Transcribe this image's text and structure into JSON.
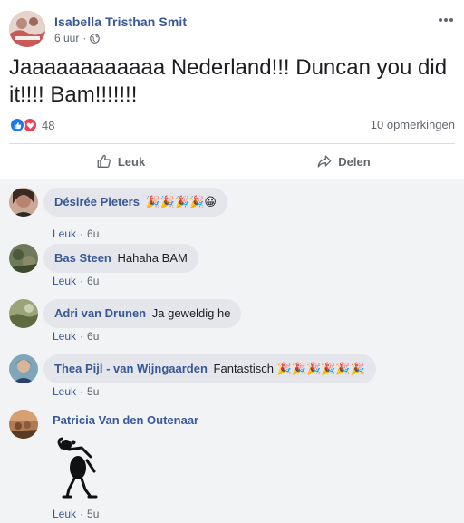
{
  "post": {
    "author": "Isabella Tristhan Smit",
    "time": "6 uur",
    "meta_separator": "·",
    "text": "Jaaaaaaaaaaaa Nederland!!! Duncan you did it!!!! Bam!!!!!!!",
    "reaction_count": "48",
    "comments_count": "10 opmerkingen",
    "reaction_types": [
      "like",
      "love"
    ]
  },
  "actions": {
    "like_label": "Leuk",
    "share_label": "Delen"
  },
  "colors": {
    "link": "#385898",
    "bubble": "#e4e6eb",
    "comments_bg": "#f2f3f5",
    "like_blue": "#1877f2",
    "love_red": "#f33e58"
  },
  "comments": [
    {
      "name": "Désirée Pieters",
      "text": "🎉🎉🎉🎉😀",
      "like_label": "Leuk",
      "sep": "·",
      "time": "6u"
    },
    {
      "name": "Bas Steen",
      "text": "Hahaha BAM",
      "like_label": "Leuk",
      "sep": "·",
      "time": "6u"
    },
    {
      "name": "Adri van Drunen",
      "text": "Ja geweldig he",
      "like_label": "Leuk",
      "sep": "·",
      "time": "6u"
    },
    {
      "name": "Thea Pijl - van Wijngaarden",
      "text": "Fantastisch 🎉🎉🎉🎉🎉🎉",
      "like_label": "Leuk",
      "sep": "·",
      "time": "5u"
    },
    {
      "name": "Patricia Van den Outenaar",
      "text": "",
      "sticker": "dancing-figure-sticker",
      "like_label": "Leuk",
      "sep": "·",
      "time": "5u"
    }
  ]
}
